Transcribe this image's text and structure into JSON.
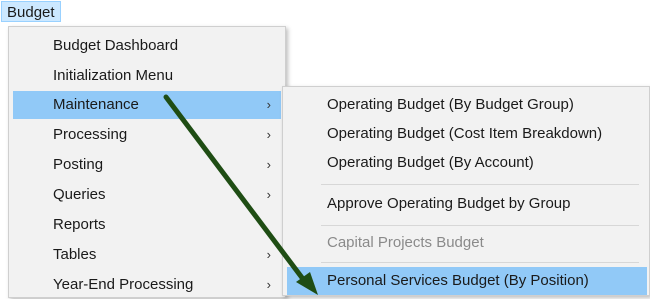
{
  "menubar": {
    "budget_label": "Budget"
  },
  "main_menu": {
    "items": [
      {
        "label": "Budget Dashboard",
        "has_submenu": false
      },
      {
        "label": "Initialization Menu",
        "has_submenu": false
      },
      {
        "label": "Maintenance",
        "has_submenu": true,
        "highlighted": true
      },
      {
        "label": "Processing",
        "has_submenu": true
      },
      {
        "label": "Posting",
        "has_submenu": true
      },
      {
        "label": "Queries",
        "has_submenu": true
      },
      {
        "label": "Reports",
        "has_submenu": false
      },
      {
        "label": "Tables",
        "has_submenu": true
      },
      {
        "label": "Year-End Processing",
        "has_submenu": true
      }
    ],
    "chevron": "›"
  },
  "submenu": {
    "items": [
      {
        "label": "Operating Budget (By Budget Group)"
      },
      {
        "label": "Operating Budget (Cost Item Breakdown)"
      },
      {
        "label": "Operating Budget (By Account)"
      },
      {
        "label": "Approve Operating Budget by Group"
      },
      {
        "label": "Capital Projects Budget",
        "disabled": true
      },
      {
        "label": "Personal Services Budget (By Position)",
        "highlighted": true
      }
    ]
  },
  "colors": {
    "highlight": "#91c9f7",
    "menubar_active": "#cce8ff",
    "menu_bg": "#f2f2f2",
    "arrow": "#1f4d14"
  },
  "annotation": {
    "type": "arrow",
    "color": "#1f4d14"
  }
}
